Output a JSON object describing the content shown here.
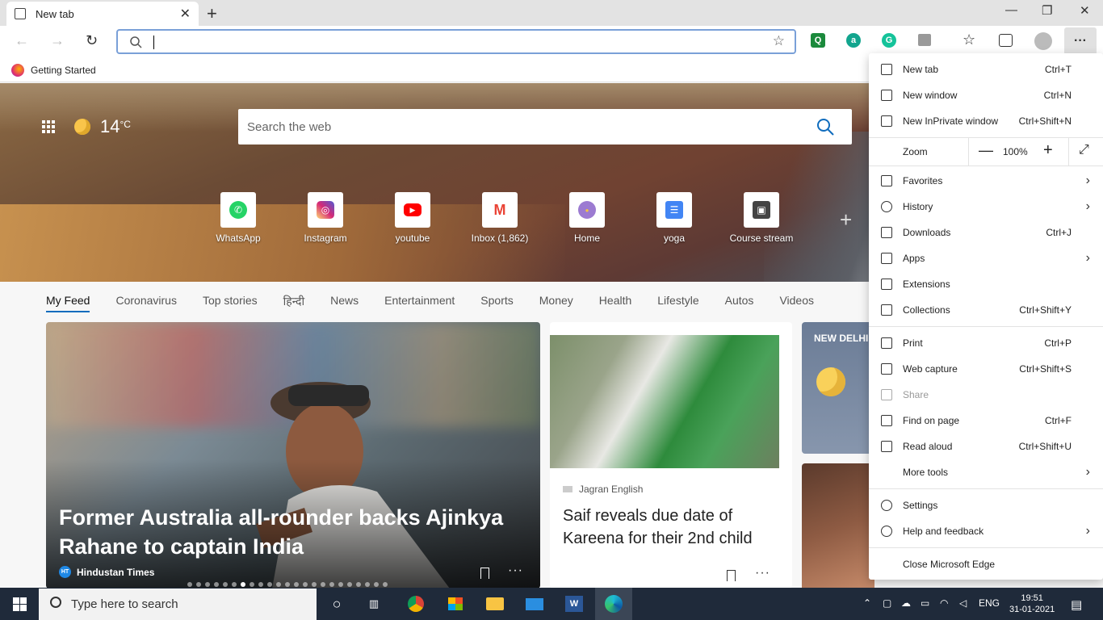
{
  "browser": {
    "tab_title": "New tab",
    "tab_close": "✕",
    "new_tab_glyph": "+",
    "address_value": "",
    "favorites_bar": [
      {
        "label": "Getting Started",
        "icon": "firefox-icon"
      }
    ],
    "extensions": [
      {
        "letter": "Q",
        "color": "#1b8a3c"
      },
      {
        "letter": "a",
        "color": "#12a58e"
      },
      {
        "letter": "G",
        "color": "#15c39a"
      }
    ],
    "more_glyph": "···"
  },
  "newtab": {
    "search_placeholder": "Search the web",
    "weather": {
      "temp": "14",
      "unit": "°C",
      "icon": "moon-icon"
    },
    "quick_links": [
      {
        "label": "WhatsApp",
        "icon": "whatsapp-icon",
        "color": "#25d366",
        "glyph": "✆"
      },
      {
        "label": "Instagram",
        "icon": "instagram-icon",
        "color": "#d6249f",
        "glyph": "◎"
      },
      {
        "label": "youtube",
        "icon": "youtube-icon",
        "color": "#ff0000",
        "glyph": "▶"
      },
      {
        "label": "Inbox (1,862)",
        "icon": "gmail-icon",
        "color": "#ea4335",
        "glyph": "M"
      },
      {
        "label": "Home",
        "icon": "home-site-icon",
        "color": "#9c7bd1",
        "glyph": "●"
      },
      {
        "label": "yoga",
        "icon": "docs-icon",
        "color": "#4285f4",
        "glyph": "☰"
      },
      {
        "label": "Course stream",
        "icon": "classroom-icon",
        "color": "#444444",
        "glyph": "▣"
      }
    ],
    "add_tile_glyph": "+",
    "feed_tabs": [
      "My Feed",
      "Coronavirus",
      "Top stories",
      "हिन्दी",
      "News",
      "Entertainment",
      "Sports",
      "Money",
      "Health",
      "Lifestyle",
      "Autos",
      "Videos"
    ],
    "feed_active": 0,
    "cards": {
      "big": {
        "headline": "Former Australia all-rounder backs Ajinkya Rahane to captain India",
        "source": "Hindustan Times",
        "source_badge": "HT"
      },
      "mid": {
        "source": "Jagran English",
        "headline": "Saif reveals due date of Kareena for their 2nd child"
      },
      "weather": {
        "city": "NEW DELHI"
      },
      "more_glyph": "···"
    }
  },
  "menu": {
    "items": [
      {
        "label": "New tab",
        "shortcut": "Ctrl+T",
        "icon": "new-tab-icon"
      },
      {
        "label": "New window",
        "shortcut": "Ctrl+N",
        "icon": "new-window-icon"
      },
      {
        "label": "New InPrivate window",
        "shortcut": "Ctrl+Shift+N",
        "icon": "inprivate-icon"
      },
      {
        "label": "Favorites",
        "shortcut": "",
        "icon": "star-icon",
        "submenu": true
      },
      {
        "label": "History",
        "shortcut": "",
        "icon": "history-icon",
        "submenu": true
      },
      {
        "label": "Downloads",
        "shortcut": "Ctrl+J",
        "icon": "download-icon"
      },
      {
        "label": "Apps",
        "shortcut": "",
        "icon": "apps-icon",
        "submenu": true
      },
      {
        "label": "Extensions",
        "shortcut": "",
        "icon": "puzzle-icon"
      },
      {
        "label": "Collections",
        "shortcut": "Ctrl+Shift+Y",
        "icon": "collections-icon"
      },
      {
        "label": "Print",
        "shortcut": "Ctrl+P",
        "icon": "print-icon"
      },
      {
        "label": "Web capture",
        "shortcut": "Ctrl+Shift+S",
        "icon": "web-capture-icon"
      },
      {
        "label": "Share",
        "shortcut": "",
        "icon": "share-icon",
        "disabled": true
      },
      {
        "label": "Find on page",
        "shortcut": "Ctrl+F",
        "icon": "find-icon"
      },
      {
        "label": "Read aloud",
        "shortcut": "Ctrl+Shift+U",
        "icon": "read-aloud-icon"
      },
      {
        "label": "More tools",
        "shortcut": "",
        "icon": "",
        "submenu": true
      },
      {
        "label": "Settings",
        "shortcut": "",
        "icon": "gear-icon"
      },
      {
        "label": "Help and feedback",
        "shortcut": "",
        "icon": "help-icon",
        "submenu": true
      },
      {
        "label": "Close Microsoft Edge",
        "shortcut": "",
        "icon": ""
      }
    ],
    "zoom": {
      "label": "Zoom",
      "value": "100%",
      "minus": "—",
      "plus": "+",
      "fullscreen": "⤢"
    },
    "chevron": "›"
  },
  "taskbar": {
    "search_placeholder": "Type here to search",
    "apps": [
      "task-view-icon",
      "chrome-icon",
      "store-icon",
      "file-explorer-icon",
      "mail-icon",
      "word-icon",
      "edge-icon"
    ],
    "language": "ENG",
    "time": "19:51",
    "date": "31-01-2021"
  }
}
